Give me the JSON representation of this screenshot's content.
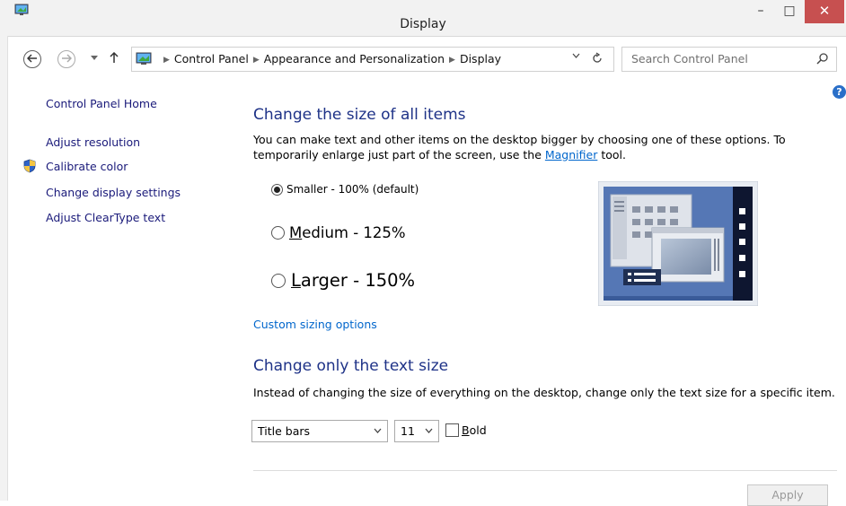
{
  "window": {
    "title": "Display",
    "minimize": "–",
    "maximize": "□",
    "close": "✕"
  },
  "addressbar": {
    "crumbs": [
      "Control Panel",
      "Appearance and Personalization",
      "Display"
    ],
    "search_placeholder": "Search Control Panel"
  },
  "leftnav": {
    "home": "Control Panel Home",
    "items": [
      "Adjust resolution",
      "Calibrate color",
      "Change display settings",
      "Adjust ClearType text"
    ]
  },
  "main": {
    "size_heading": "Change the size of all items",
    "size_desc_1": "You can make text and other items on the desktop bigger by choosing one of these options. To temporarily enlarge just part of the screen, use the ",
    "magnifier_link": "Magnifier",
    "size_desc_2": " tool.",
    "options": [
      {
        "label": "Smaller - 100% (default)",
        "selected": true
      },
      {
        "label_first": "M",
        "label_rest": "edium - 125%",
        "selected": false
      },
      {
        "label_first": "L",
        "label_rest": "arger - 150%",
        "selected": false
      }
    ],
    "custom_link": "Custom sizing options",
    "text_heading": "Change only the text size",
    "text_desc": "Instead of changing the size of everything on the desktop, change only the text size for a specific item.",
    "item_select": "Title bars",
    "size_select": "11",
    "bold_first": "B",
    "bold_rest": "old",
    "bold_checked": false,
    "apply": "Apply"
  },
  "colors": {
    "heading": "#1e3287",
    "link": "#0066cc",
    "close_button": "#c75050",
    "preview_bg": "#4d6fae"
  }
}
